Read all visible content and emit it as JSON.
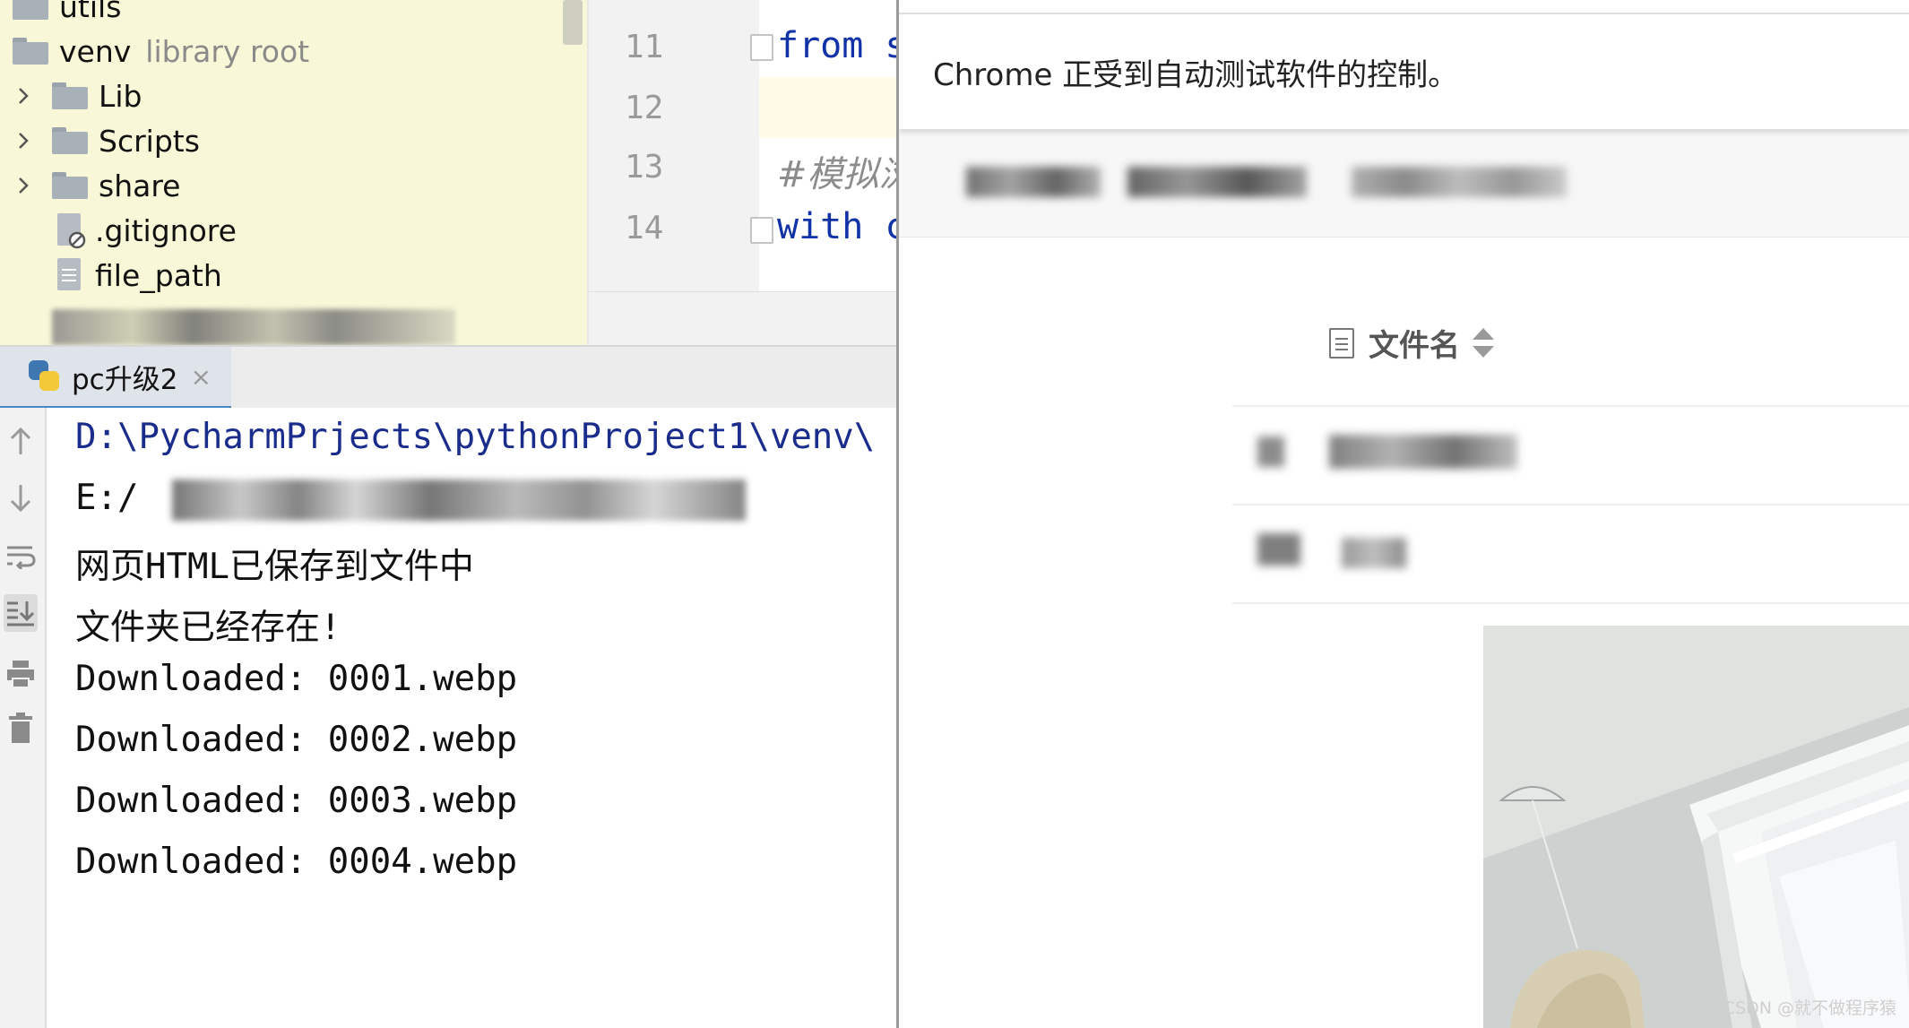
{
  "project_tree": {
    "items": [
      {
        "label": "utils",
        "type": "folder"
      },
      {
        "label": "venv",
        "hint": "library root",
        "type": "folder"
      },
      {
        "label": "Lib",
        "type": "folder",
        "expandable": true
      },
      {
        "label": "Scripts",
        "type": "folder",
        "expandable": true
      },
      {
        "label": "share",
        "type": "folder",
        "expandable": true
      },
      {
        "label": ".gitignore",
        "type": "file"
      },
      {
        "label": "file_path",
        "type": "file"
      }
    ]
  },
  "editor": {
    "lines": [
      {
        "num": "11",
        "code": "from s",
        "fold": true
      },
      {
        "num": "12",
        "code": ""
      },
      {
        "num": "13",
        "code": "#模拟浏",
        "comment": true
      },
      {
        "num": "14",
        "code": "with c",
        "fold": true
      }
    ]
  },
  "run_window": {
    "tab_label": "pc升级2",
    "close_glyph": "×",
    "output": [
      "D:\\PycharmPrjects\\pythonProject1\\venv\\",
      "E:/",
      "网页HTML已保存到文件中",
      "文件夹已经存在!",
      "Downloaded: 0001.webp",
      "Downloaded: 0002.webp",
      "Downloaded: 0003.webp",
      "Downloaded: 0004.webp"
    ],
    "toolbar_icons": [
      "arrow-up-icon",
      "arrow-down-icon",
      "soft-wrap-icon",
      "scroll-to-end-icon",
      "print-icon",
      "trash-icon"
    ]
  },
  "chrome": {
    "automation_message": "Chrome 正受到自动测试软件的控制。",
    "table_header": "文件名"
  },
  "watermark": "CSDN @就不做程序猿",
  "colors": {
    "tree_background": "#f8f8d8",
    "keyword_blue": "#1232a8",
    "run_tab_accent": "#4a88c7"
  }
}
